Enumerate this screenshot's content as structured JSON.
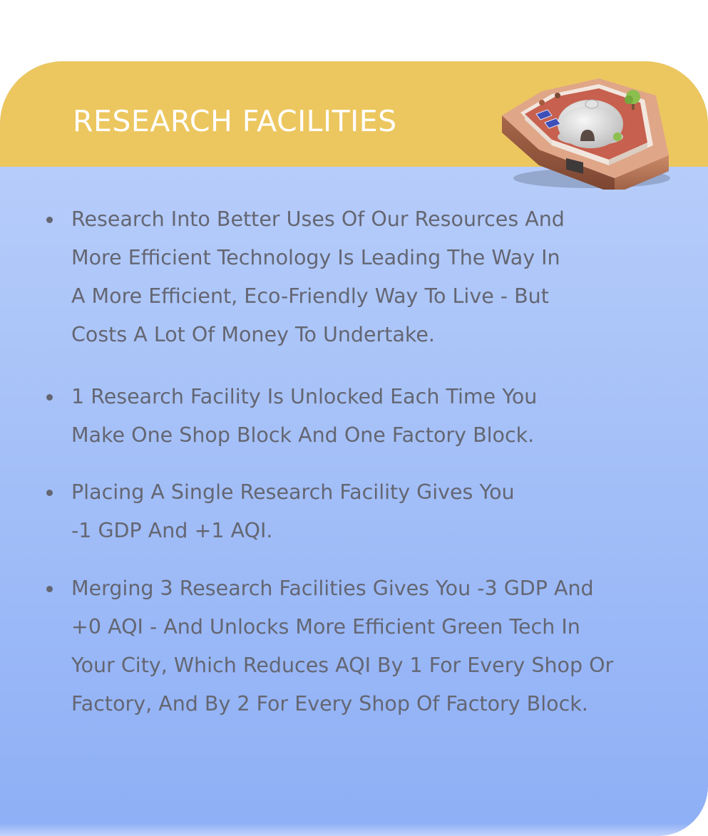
{
  "card": {
    "title": "RESEARCH FACILITIES",
    "header_color": "#ecc75f",
    "body_gradient": [
      "#bdd1fb",
      "#8eaff6"
    ],
    "illustration": "research-facility-dome-icon"
  },
  "bullets": [
    {
      "text": "Research Into Better Uses Of Our Resources And\nMore Efficient Technology Is Leading The Way In\nA More Efficient, Eco-Friendly Way To Live - But\nCosts A Lot Of Money To Undertake."
    },
    {
      "text": "1 Research Facility Is Unlocked Each Time You\nMake One Shop Block And One Factory Block."
    },
    {
      "text": "Placing A Single Research Facility Gives You\n-1 GDP And +1 AQI."
    },
    {
      "text": "Merging 3 Research Facilities Gives You -3 GDP And\n+0 AQI - And Unlocks More Efficient Green Tech In\nYour City, Which Reduces AQI By 1 For Every Shop Or\nFactory, And By 2 For Every Shop Of Factory Block."
    }
  ]
}
